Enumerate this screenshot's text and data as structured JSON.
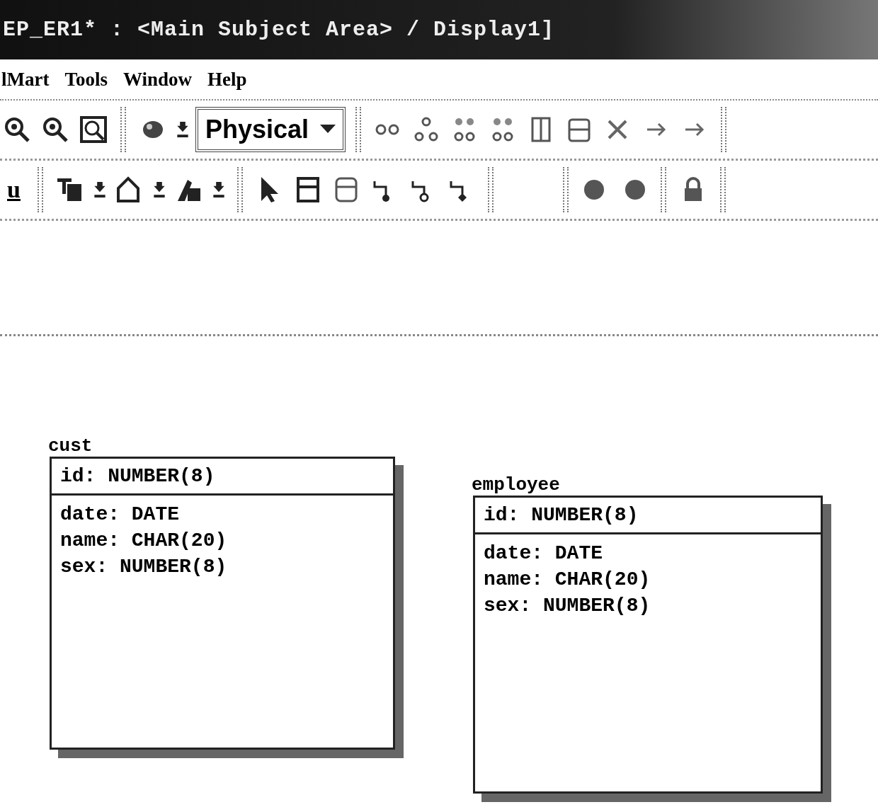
{
  "window": {
    "title": "EP_ER1* : <Main Subject Area> / Display1]"
  },
  "menu": [
    {
      "label": "lMart"
    },
    {
      "label": "Tools"
    },
    {
      "label": "Window"
    },
    {
      "label": "Help"
    }
  ],
  "toolbar": {
    "view_select": {
      "value": "Physical"
    },
    "underline_button": "u"
  },
  "entities": [
    {
      "name": "cust",
      "keys": [
        "id: NUMBER(8)"
      ],
      "attributes": [
        "date: DATE",
        "name: CHAR(20)",
        "sex: NUMBER(8)"
      ]
    },
    {
      "name": "employee",
      "keys": [
        "id: NUMBER(8)"
      ],
      "attributes": [
        "date: DATE",
        "name: CHAR(20)",
        "sex: NUMBER(8)"
      ]
    }
  ]
}
